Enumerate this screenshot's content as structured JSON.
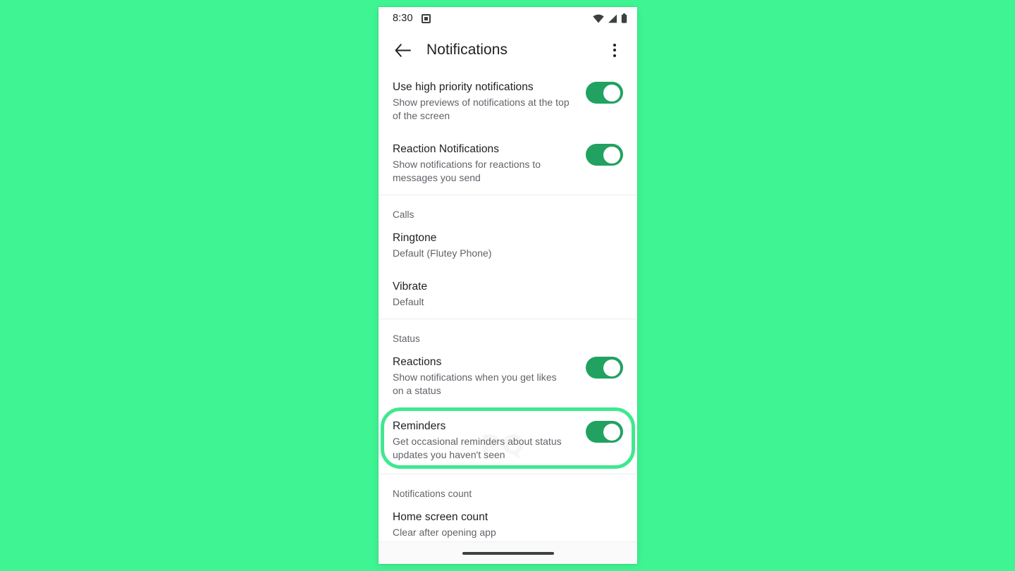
{
  "theme": {
    "page_background": "#3ff593",
    "accent_green": "#21a260",
    "highlight_border": "#3fe88f",
    "text_primary": "#202124",
    "text_secondary": "#5f6368"
  },
  "status_bar": {
    "time": "8:30",
    "app_icon": "app-notification-icon",
    "icons": [
      "wifi-icon",
      "cellular-signal-icon",
      "battery-icon"
    ]
  },
  "app_bar": {
    "back_icon": "back-arrow-icon",
    "title": "Notifications",
    "overflow_icon": "overflow-menu-icon"
  },
  "sections": [
    {
      "header": null,
      "rows": [
        {
          "title": "Use high priority notifications",
          "subtitle": "Show previews of notifications at the top of the screen",
          "toggle": "on"
        },
        {
          "title": "Reaction Notifications",
          "subtitle": "Show notifications for reactions to messages you send",
          "toggle": "on"
        }
      ]
    },
    {
      "header": "Calls",
      "rows": [
        {
          "title": "Ringtone",
          "subtitle": "Default (Flutey Phone)",
          "toggle": null
        },
        {
          "title": "Vibrate",
          "subtitle": "Default",
          "toggle": null
        }
      ]
    },
    {
      "header": "Status",
      "rows": [
        {
          "title": "Reactions",
          "subtitle": "Show notifications when you get likes on a status",
          "toggle": "on"
        },
        {
          "title": "Reminders",
          "subtitle": "Get occasional reminders about status updates you haven't seen",
          "toggle": "on",
          "highlighted": true
        }
      ]
    },
    {
      "header": "Notifications count",
      "rows": [
        {
          "title": "Home screen count",
          "subtitle": "Clear after opening app",
          "toggle": null
        }
      ]
    }
  ],
  "watermark": {
    "text": "PQ"
  },
  "nav_bar": {
    "handle": "gesture-handle"
  }
}
